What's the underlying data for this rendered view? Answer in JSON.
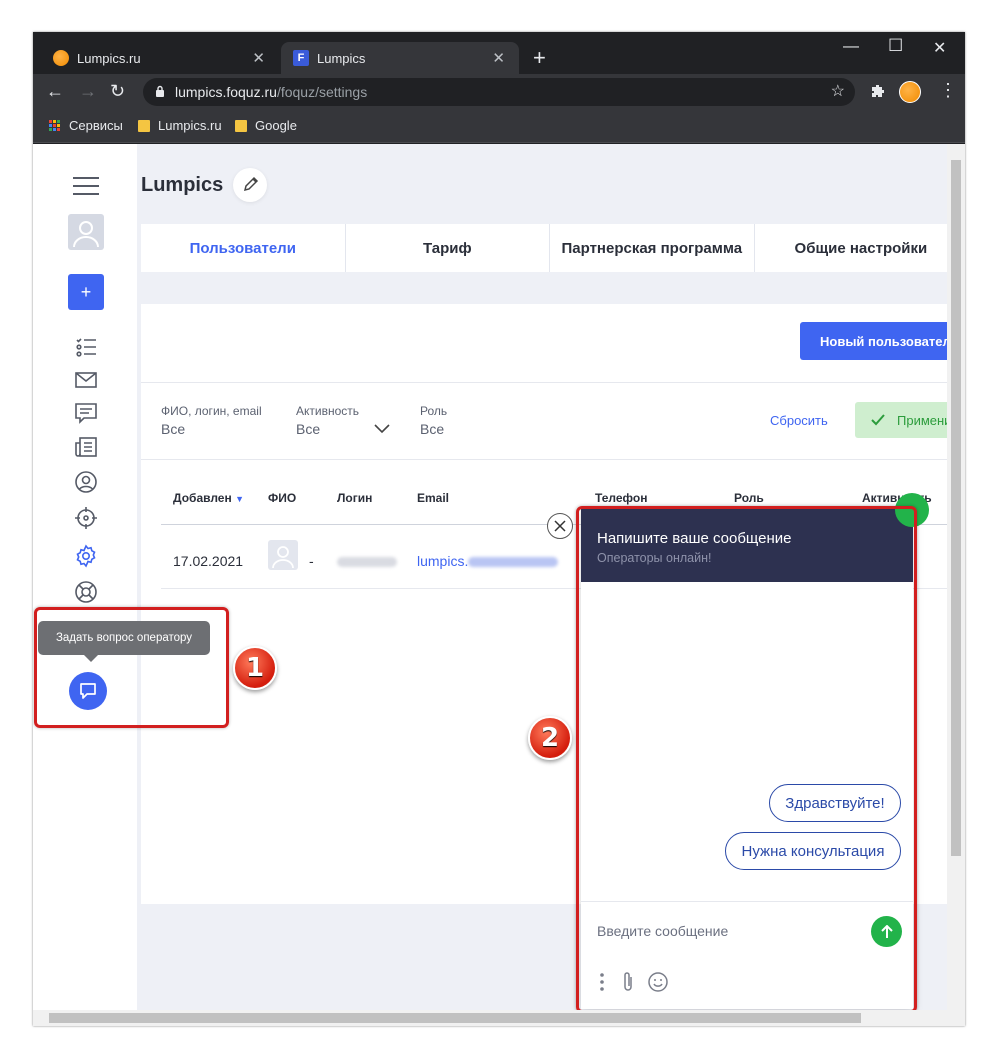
{
  "browser": {
    "tabs": [
      {
        "title": "Lumpics.ru",
        "active": false
      },
      {
        "title": "Lumpics",
        "active": true
      }
    ],
    "url_host": "lumpics.foquz.ru",
    "url_path": "/foquz/settings",
    "bookmarks": [
      "Сервисы",
      "Lumpics.ru",
      "Google"
    ]
  },
  "page": {
    "title": "Lumpics",
    "tabs": [
      "Пользователи",
      "Тариф",
      "Партнерская программа",
      "Общие настройки"
    ],
    "new_user_button": "Новый пользователь",
    "filters": [
      {
        "label": "ФИО, логин, email",
        "value": "Все"
      },
      {
        "label": "Активность",
        "value": "Все"
      },
      {
        "label": "Роль",
        "value": "Все"
      }
    ],
    "reset_label": "Сбросить",
    "apply_label": "Применить",
    "table": {
      "columns": [
        "Добавлен",
        "ФИО",
        "Логин",
        "Email",
        "Телефон",
        "Роль",
        "Активность"
      ],
      "rows": [
        {
          "date": "17.02.2021",
          "name": "-",
          "email_prefix": "lumpics."
        }
      ]
    }
  },
  "tooltip": "Задать вопрос оператору",
  "chat": {
    "header_title": "Напишите ваше сообщение",
    "header_subtitle": "Операторы онлайн!",
    "quick_replies": [
      "Здравствуйте!",
      "Нужна консультация"
    ],
    "input_placeholder": "Введите сообщение"
  },
  "annotations": [
    "1",
    "2"
  ],
  "colors": {
    "accent": "#3f65f1",
    "chat_header": "#2d3150",
    "online_green": "#22b34a",
    "annotation_red": "#d21f1f"
  }
}
